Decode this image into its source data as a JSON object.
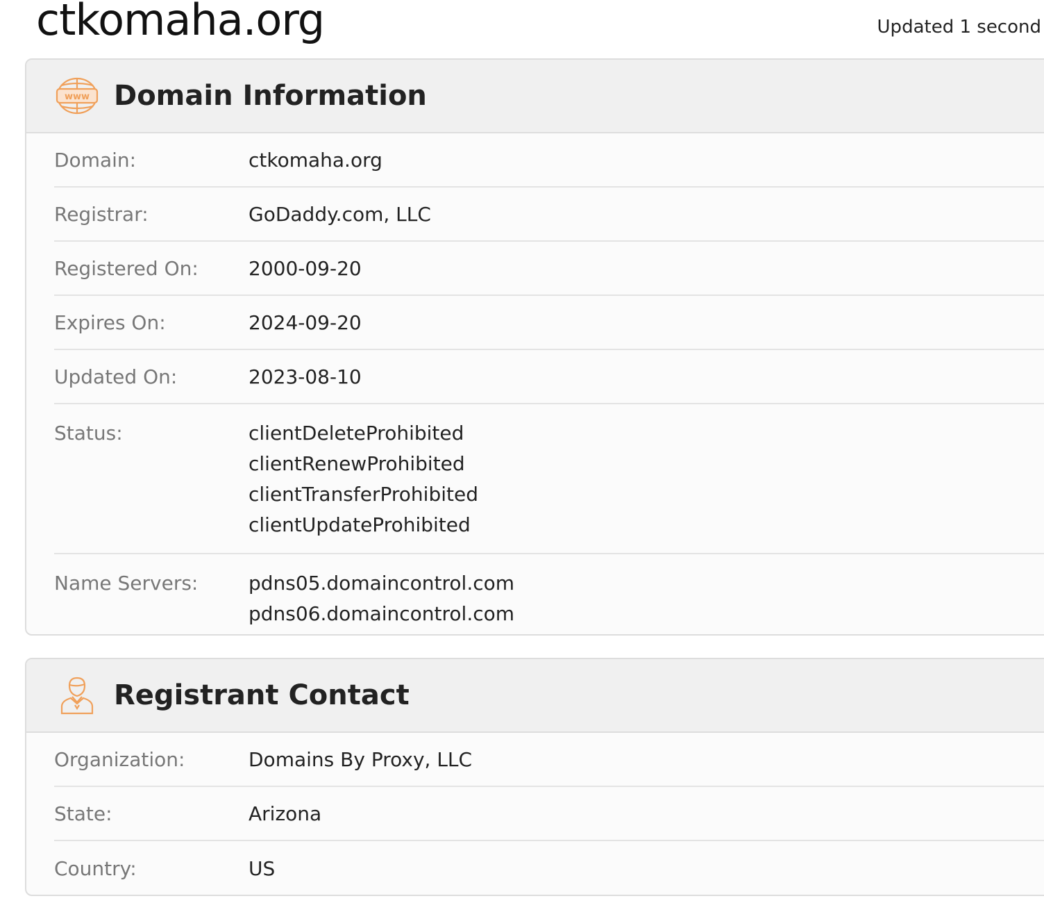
{
  "header": {
    "title": "ctkomaha.org",
    "updated_text": "Updated 1 second"
  },
  "domain_info": {
    "title": "Domain Information",
    "icon": "www-globe-icon",
    "rows": [
      {
        "label": "Domain:",
        "values": [
          "ctkomaha.org"
        ]
      },
      {
        "label": "Registrar:",
        "values": [
          "GoDaddy.com, LLC"
        ]
      },
      {
        "label": "Registered On:",
        "values": [
          "2000-09-20"
        ]
      },
      {
        "label": "Expires On:",
        "values": [
          "2024-09-20"
        ]
      },
      {
        "label": "Updated On:",
        "values": [
          "2023-08-10"
        ]
      },
      {
        "label": "Status:",
        "values": [
          "clientDeleteProhibited",
          "clientRenewProhibited",
          "clientTransferProhibited",
          "clientUpdateProhibited"
        ]
      },
      {
        "label": "Name Servers:",
        "values": [
          "pdns05.domaincontrol.com",
          "pdns06.domaincontrol.com"
        ]
      }
    ]
  },
  "registrant": {
    "title": "Registrant Contact",
    "icon": "person-icon",
    "rows": [
      {
        "label": "Organization:",
        "values": [
          "Domains By Proxy, LLC"
        ]
      },
      {
        "label": "State:",
        "values": [
          "Arizona"
        ]
      },
      {
        "label": "Country:",
        "values": [
          "US"
        ]
      }
    ]
  },
  "colors": {
    "accent": "#f0a05a",
    "header_bg": "#f0f0f0",
    "label": "#777777",
    "border": "#dddddd"
  }
}
